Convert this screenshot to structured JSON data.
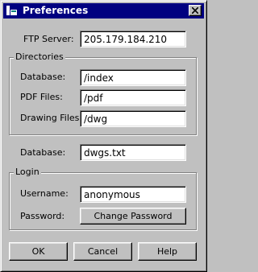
{
  "window": {
    "title": "Preferences",
    "icon": "app-icon",
    "close_icon": "close-icon"
  },
  "ftp": {
    "label": "FTP Server:",
    "value": "205.179.184.210"
  },
  "directories": {
    "title": "Directories",
    "database": {
      "label": "Database:",
      "value": "/index"
    },
    "pdf": {
      "label": "PDF Files:",
      "value": "/pdf"
    },
    "drawing": {
      "label": "Drawing Files:",
      "value": "/dwg"
    }
  },
  "database_file": {
    "label": "Database:",
    "value": "dwgs.txt"
  },
  "login": {
    "title": "Login",
    "username": {
      "label": "Username:",
      "value": "anonymous"
    },
    "password": {
      "label": "Password:",
      "button": "Change Password"
    }
  },
  "buttons": {
    "ok": "OK",
    "cancel": "Cancel",
    "help": "Help"
  },
  "colors": {
    "titlebar": "#000080",
    "face": "#c0c0c0",
    "field": "#ffffff"
  }
}
